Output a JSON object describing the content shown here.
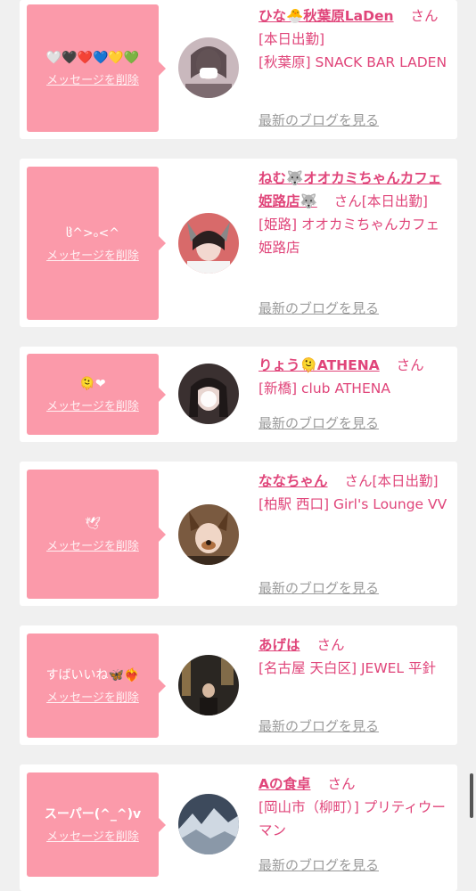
{
  "cards": [
    {
      "message": "🤍🖤❤️💙💛💚",
      "delete_label": "メッセージを削除",
      "name": "ひな🐣秋葉原LaDen",
      "san": "さん",
      "status": "[本日出勤]",
      "shop": "[秋葉原] SNACK BAR LADEN",
      "blog_label": "最新のブログを見る",
      "avatar_color": "#c9b8bd"
    },
    {
      "message": "ჱ̒^>ₒ<^",
      "delete_label": "メッセージを削除",
      "name": "ねむ🐺オオカミちゃんカフェ姫路店🐺",
      "san": "さん",
      "status": "[本日出勤]",
      "shop": "[姫路] オオカミちゃんカフェ姫路店",
      "blog_label": "最新のブログを見る",
      "avatar_color": "#d86a6a"
    },
    {
      "message": "🫠❤",
      "delete_label": "メッセージを削除",
      "name": "りょう🫠ATHENA",
      "san": "さん",
      "status": "",
      "shop": "[新橋] club ATHENA",
      "blog_label": "最新のブログを見る",
      "avatar_color": "#3a3030"
    },
    {
      "message": "🕊",
      "delete_label": "メッセージを削除",
      "name": "ななちゃん",
      "san": "さん",
      "status": "[本日出勤]",
      "shop": "[柏駅 西口] Girl's Lounge VV",
      "blog_label": "最新のブログを見る",
      "avatar_color": "#7a5a40"
    },
    {
      "message": "すばいいね🦋❤️‍🔥",
      "delete_label": "メッセージを削除",
      "name": "あげは",
      "san": "さん",
      "status": "",
      "shop": "[名古屋 天白区] JEWEL 平針",
      "blog_label": "最新のブログを見る",
      "avatar_color": "#2a2622"
    },
    {
      "message": "スーパー(^_^)v",
      "delete_label": "メッセージを削除",
      "name": "Aの食卓",
      "san": "さん",
      "status": "",
      "shop": "[岡山市（柳町）] プリティウーマン",
      "blog_label": "最新のブログを見る",
      "avatar_color": "#3d4a5c"
    }
  ]
}
